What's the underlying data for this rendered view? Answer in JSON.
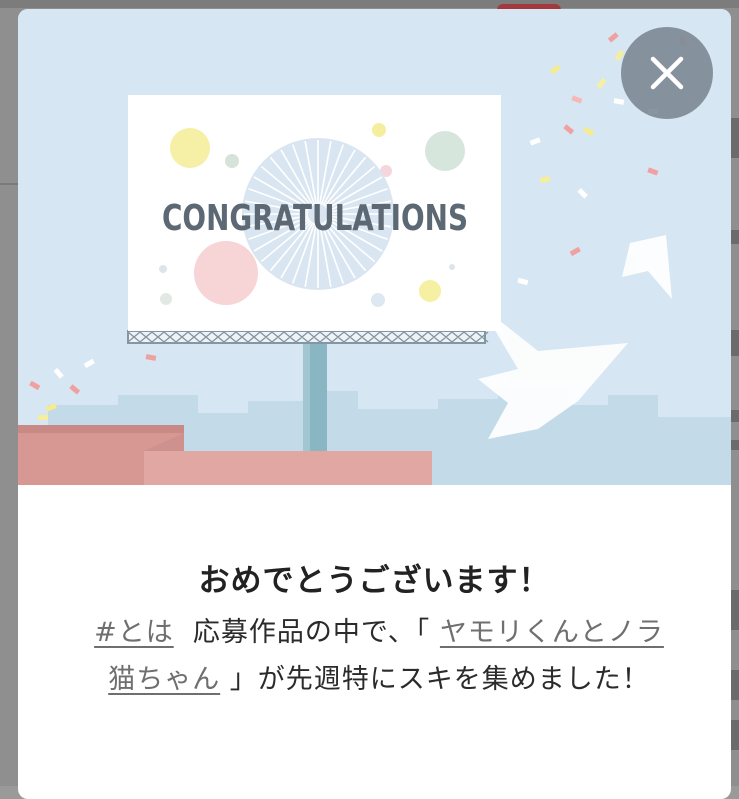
{
  "modal": {
    "billboard_text": "CONGRATULATIONS",
    "close_icon": "close-icon",
    "title": "おめでとうございます！",
    "message": {
      "hashtag_link": "#とは",
      "text_after_hashtag": "応募作品の中で、「",
      "article_link": "ヤモリくんとノラ猫ちゃん",
      "text_end": "」が先週特にスキを集めました！"
    }
  },
  "colors": {
    "sky": "#d6e6f2",
    "billboard": "#ffffff",
    "billboard_text": "#5c6873",
    "rooftop": "#e0a7a3",
    "close_button": "#7a8691"
  }
}
